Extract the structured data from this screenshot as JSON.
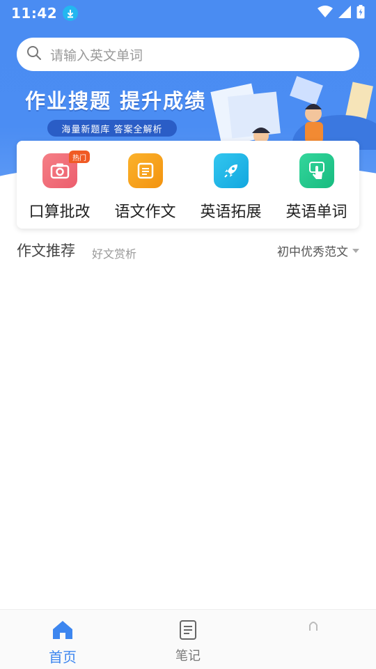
{
  "status_bar": {
    "time": "11:42",
    "icons": [
      "download-icon",
      "wifi-icon",
      "signal-icon",
      "battery-charging-icon"
    ]
  },
  "search": {
    "placeholder": "请输入英文单词"
  },
  "banner": {
    "title": "作业搜题 提升成绩",
    "subtitle": "海量新题库  答案全解析"
  },
  "features": [
    {
      "label": "口算批改",
      "icon": "camera-icon",
      "color": "#f2707a",
      "badge": "热门"
    },
    {
      "label": "语文作文",
      "icon": "document-icon",
      "color": "#f7a21b"
    },
    {
      "label": "英语拓展",
      "icon": "rocket-icon",
      "color": "#1fb7e8"
    },
    {
      "label": "英语单词",
      "icon": "tap-icon",
      "color": "#22c98d"
    }
  ],
  "section": {
    "title": "作文推荐",
    "subtitle": "好文赏析",
    "filter": "初中优秀范文"
  },
  "bottom_nav": [
    {
      "label": "首页",
      "icon": "home-icon",
      "active": true
    },
    {
      "label": "笔记",
      "icon": "notes-icon",
      "active": false
    },
    {
      "label": "",
      "icon": "profile-icon",
      "active": false
    }
  ],
  "colors": {
    "brand_blue": "#4a8cf2",
    "active_tab": "#3d86ef",
    "hot_badge": "#f05a24"
  }
}
